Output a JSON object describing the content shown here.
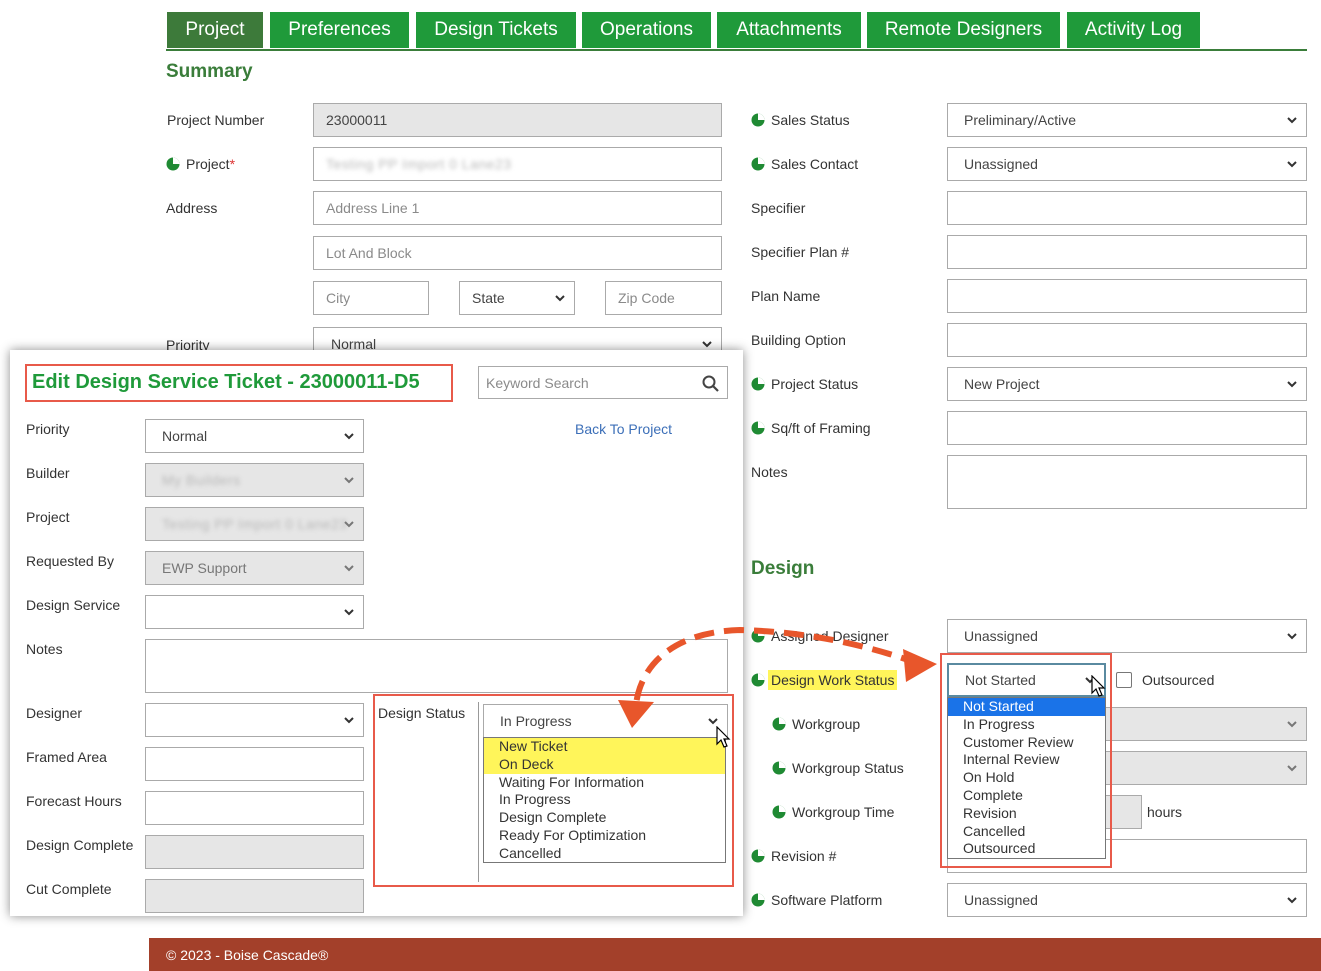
{
  "tabs": [
    "Project",
    "Preferences",
    "Design Tickets",
    "Operations",
    "Attachments",
    "Remote Designers",
    "Activity Log"
  ],
  "summary": {
    "title": "Summary",
    "project_number_label": "Project Number",
    "project_number": "23000011",
    "project_label": "Project",
    "project_required": "*",
    "project_value": "Testing PP Import 0 Lane23",
    "address_label": "Address",
    "address_line1_placeholder": "Address Line 1",
    "lot_block_placeholder": "Lot And Block",
    "city_placeholder": "City",
    "state_label": "State",
    "zip_placeholder": "Zip Code",
    "priority_label": "Priority",
    "priority_value": "Normal"
  },
  "right_fields": {
    "sales_status_label": "Sales Status",
    "sales_status": "Preliminary/Active",
    "sales_contact_label": "Sales Contact",
    "sales_contact": "Unassigned",
    "specifier_label": "Specifier",
    "specifier_plan_label": "Specifier Plan #",
    "plan_name_label": "Plan Name",
    "building_option_label": "Building Option",
    "project_status_label": "Project Status",
    "project_status": "New Project",
    "sqft_label": "Sq/ft of Framing",
    "notes_label": "Notes"
  },
  "design": {
    "title": "Design",
    "assigned_designer_label": "Assigned Designer",
    "assigned_designer": "Unassigned",
    "work_status_label": "Design Work Status",
    "work_status": "Not Started",
    "outsourced_label": "Outsourced",
    "work_status_options": [
      "Not Started",
      "In Progress",
      "Customer Review",
      "Internal Review",
      "On Hold",
      "Complete",
      "Revision",
      "Cancelled",
      "Outsourced"
    ],
    "workgroup_label": "Workgroup",
    "workgroup_status_label": "Workgroup Status",
    "workgroup_time_label": "Workgroup Time",
    "hours_label": "hours",
    "revision_label": "Revision #",
    "software_platform_label": "Software Platform",
    "software_platform": "Unassigned"
  },
  "modal": {
    "title": "Edit Design Service Ticket - 23000011-D5",
    "search_placeholder": "Keyword Search",
    "back_link": "Back To Project",
    "priority_label": "Priority",
    "priority": "Normal",
    "builder_label": "Builder",
    "builder": "My Builders",
    "project_label": "Project",
    "project": "Testing PP Import 0 Lane23",
    "requested_by_label": "Requested By",
    "requested_by": "EWP Support",
    "design_service_label": "Design Service",
    "notes_label": "Notes",
    "designer_label": "Designer",
    "framed_area_label": "Framed Area",
    "forecast_hours_label": "Forecast Hours",
    "design_complete_label": "Design Complete",
    "cut_complete_label": "Cut Complete",
    "design_status_label": "Design Status",
    "design_status": "In Progress",
    "design_status_options": [
      "New Ticket",
      "On Deck",
      "Waiting For Information",
      "In Progress",
      "Design Complete",
      "Ready For Optimization",
      "Cancelled"
    ]
  },
  "footer": "© 2023 - Boise Cascade®",
  "colors": {
    "brand_green": "#1f9a3a",
    "active_tab": "#3d7a3a",
    "footer": "#a3402a",
    "annotation": "#e85a4a",
    "highlight": "#fff55a"
  }
}
